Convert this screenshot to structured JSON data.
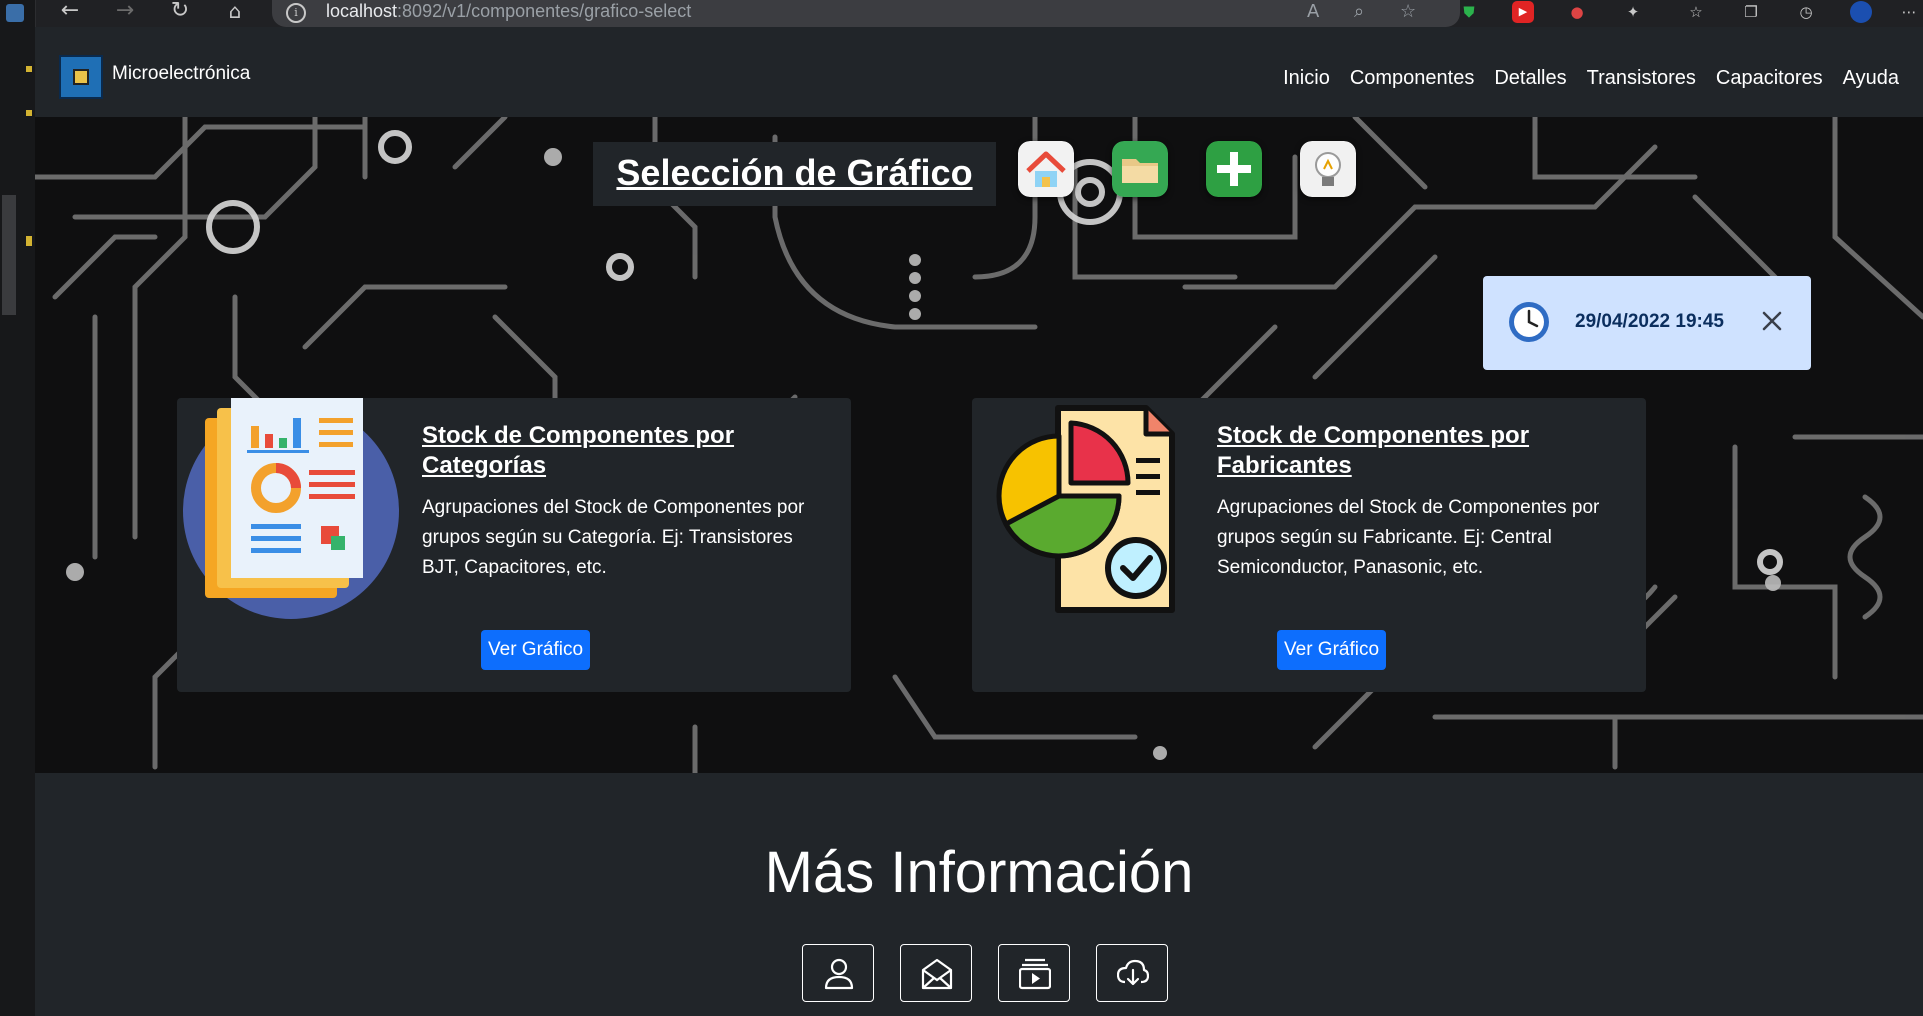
{
  "browser": {
    "url_host": "localhost",
    "url_path": ":8092/v1/componentes/grafico-select",
    "icons": [
      "back-icon",
      "forward-icon",
      "reload-icon",
      "home-icon",
      "info-icon",
      "read-aloud-icon",
      "zoom-icon",
      "favorite-add-icon",
      "shield-extension-icon",
      "youtube-extension-icon",
      "flag-extension-icon",
      "extensions-icon",
      "favorites-icon",
      "collections-icon",
      "history-icon",
      "profile-icon",
      "more-icon"
    ]
  },
  "navbar": {
    "brand": "Microelectrónica",
    "links": [
      "Inicio",
      "Componentes",
      "Detalles",
      "Transistores",
      "Capacitores",
      "Ayuda"
    ]
  },
  "hero": {
    "title": "Selección de Gráfico",
    "quick_icons": [
      "home-app-icon",
      "folder-app-icon",
      "add-app-icon",
      "lightbulb-app-icon"
    ]
  },
  "toast": {
    "datetime": "29/04/2022 19:45"
  },
  "cards": [
    {
      "title": "Stock de Componentes por Categorías",
      "text": "Agrupaciones del Stock de Componentes por grupos según su Categoría. Ej: Transistores BJT, Capacitores, etc.",
      "button": "Ver Gráfico"
    },
    {
      "title": "Stock de Componentes por Fabricantes",
      "text": "Agrupaciones del Stock de Componentes por grupos según su Fabricante. Ej: Central Semiconductor, Panasonic, etc.",
      "button": "Ver Gráfico"
    }
  ],
  "info": {
    "title": "Más Información",
    "buttons": [
      "user-icon",
      "mail-icon",
      "media-icon",
      "cloud-download-icon"
    ]
  },
  "colors": {
    "navbar_bg": "#212529",
    "primary_button": "#0d6efd",
    "toast_bg": "#cfe2ff",
    "toast_text": "#0b2e5e"
  }
}
